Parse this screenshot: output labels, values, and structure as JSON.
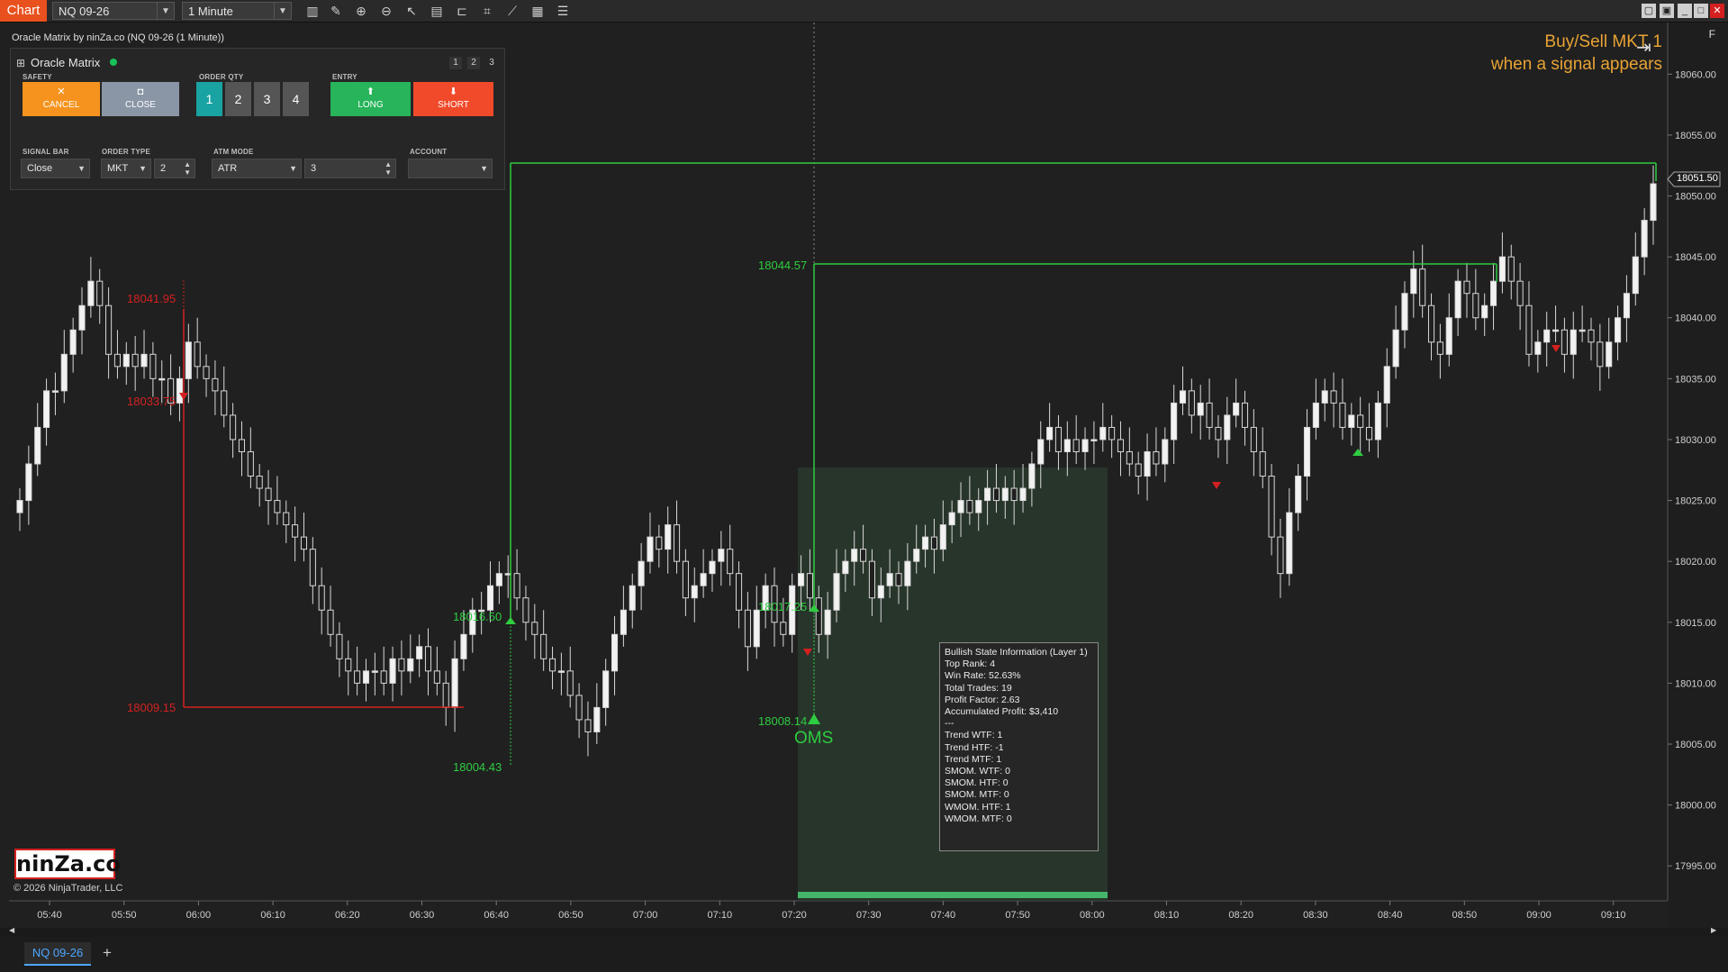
{
  "toolbar": {
    "chart_tab": "Chart",
    "instrument": "NQ 09-26",
    "interval": "1 Minute"
  },
  "chart": {
    "subtitle": "Oracle Matrix by ninZa.co (NQ 09-26 (1 Minute))",
    "f_button": "F",
    "signal_line1": "Buy/Sell MKT 1",
    "signal_line2": "when a signal appears",
    "current_price": "18051.50",
    "oms_label": "OMS",
    "price_labels": {
      "red_high": "18041.95",
      "red_entry": "18033.75",
      "red_target": "18009.15",
      "green_entry_left": "18016.50",
      "green_stop_left": "18004.43",
      "green_target_mid": "18044.57",
      "green_entry_mid": "18017.25",
      "green_stop_mid": "18008.14"
    }
  },
  "panel": {
    "title": "Oracle Matrix",
    "pages": [
      "1",
      "2",
      "3"
    ],
    "safety_label": "SAFETY",
    "cancel_label": "CANCEL",
    "close_label": "CLOSE",
    "order_qty_label": "ORDER QTY",
    "qty_options": [
      "1",
      "2",
      "3",
      "4"
    ],
    "entry_label": "ENTRY",
    "long_label": "LONG",
    "short_label": "SHORT",
    "signal_bar_label": "SIGNAL BAR",
    "signal_bar_value": "Close",
    "order_type_label": "ORDER TYPE",
    "order_type_value": "MKT",
    "order_type_qty": "2",
    "atm_mode_label": "ATM MODE",
    "atm_mode_value": "ATR",
    "atm_mode_qty": "3",
    "account_label": "ACCOUNT",
    "account_value": ""
  },
  "info_box": {
    "lines": [
      "Bullish State Information (Layer 1)",
      "Top Rank: 4",
      "Win Rate: 52.63%",
      "Total Trades: 19",
      "Profit Factor: 2.63",
      "Accumulated Profit: $3,410",
      "---",
      "Trend WTF: 1",
      "Trend HTF: -1",
      "Trend MTF: 1",
      "SMOM. WTF: 0",
      "SMOM. HTF: 0",
      "SMOM. MTF: 0",
      "WMOM. HTF: 1",
      "WMOM. MTF: 0"
    ]
  },
  "footer": {
    "logo": "ninZa.co",
    "copyright": "© 2026 NinjaTrader, LLC",
    "instrument_tab": "NQ 09-26",
    "add_tab": "+"
  },
  "colors": {
    "background": "#202020",
    "bull": "#2ecc40",
    "bear": "#d42020",
    "signal_text": "#e8a334",
    "cancel": "#f5931e",
    "close": "#8a96a6",
    "qty_active": "#1aa3a3",
    "long": "#27b45a",
    "short": "#f04a2a"
  },
  "chart_data": {
    "type": "candlestick",
    "y_ticks": [
      17995.0,
      18000.0,
      18005.0,
      18010.0,
      18015.0,
      18020.0,
      18025.0,
      18030.0,
      18035.0,
      18040.0,
      18045.0,
      18050.0,
      18055.0,
      18060.0
    ],
    "y_tick_labels": [
      "17995.00",
      "18000.00",
      "18005.00",
      "18010.00",
      "18015.00",
      "18020.00",
      "18025.00",
      "18030.00",
      "18035.00",
      "18040.00",
      "18045.00",
      "18050.00",
      "18055.00",
      "18060.00"
    ],
    "x_tick_labels": [
      "05:40",
      "05:50",
      "06:00",
      "06:10",
      "06:20",
      "06:30",
      "06:40",
      "06:50",
      "07:00",
      "07:10",
      "07:20",
      "07:30",
      "07:40",
      "07:50",
      "08:00",
      "08:10",
      "08:20",
      "08:30",
      "08:40",
      "08:50",
      "09:00",
      "09:10"
    ],
    "ylim": [
      17992.5,
      18063.5
    ],
    "closes": [
      18025,
      18028,
      18031,
      18034,
      18034,
      18037,
      18039,
      18041,
      18043,
      18041,
      18037,
      18036,
      18037,
      18036,
      18037,
      18035,
      18035,
      18033,
      18035,
      18038,
      18036,
      18035,
      18034,
      18032,
      18030,
      18029,
      18027,
      18026,
      18025,
      18024,
      18023,
      18022,
      18021,
      18018,
      18016,
      18014,
      18012,
      18011,
      18010,
      18011,
      18011,
      18010,
      18012,
      18011,
      18012,
      18013,
      18011,
      18010,
      18008,
      18012,
      18014,
      18016,
      18016,
      18018,
      18019,
      18019,
      18017,
      18015,
      18014,
      18012,
      18011,
      18011,
      18009,
      18007,
      18006,
      18008,
      18011,
      18014,
      18016,
      18018,
      18020,
      18022,
      18021,
      18023,
      18020,
      18017,
      18018,
      18019,
      18020,
      18021,
      18019,
      18016,
      18013,
      18016,
      18018,
      18015,
      18014,
      18018,
      18019,
      18017,
      18014,
      18016,
      18019,
      18020,
      18021,
      18020,
      18017,
      18018,
      18019,
      18018,
      18020,
      18021,
      18022,
      18021,
      18023,
      18024,
      18025,
      18024,
      18025,
      18026,
      18025,
      18026,
      18025,
      18026,
      18028,
      18030,
      18031,
      18029,
      18030,
      18029,
      18030,
      18030,
      18031,
      18030,
      18029,
      18028,
      18027,
      18029,
      18028,
      18030,
      18033,
      18034,
      18032,
      18033,
      18031,
      18030,
      18032,
      18033,
      18031,
      18029,
      18027,
      18022,
      18019,
      18024,
      18027,
      18031,
      18033,
      18034,
      18033,
      18031,
      18032,
      18031,
      18030,
      18033,
      18036,
      18039,
      18042,
      18044,
      18041,
      18038,
      18037,
      18040,
      18043,
      18042,
      18040,
      18041,
      18043,
      18045,
      18043,
      18041,
      18037,
      18038,
      18039,
      18039,
      18037,
      18039,
      18039,
      18038,
      18036,
      18038,
      18040,
      18042,
      18045,
      18048,
      18051
    ]
  }
}
